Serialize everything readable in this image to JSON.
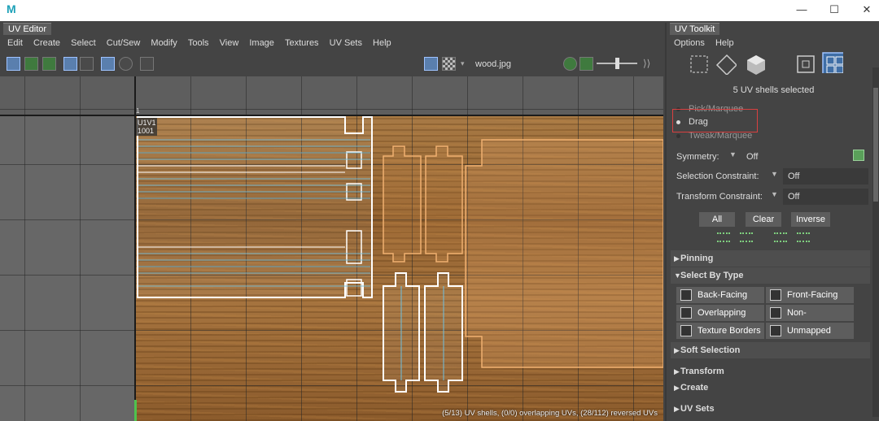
{
  "window": {
    "logo": "M",
    "minimize": "—",
    "maximize": "☐",
    "close": "✕"
  },
  "uv_editor": {
    "tab_title": "UV Editor",
    "menu": [
      "Edit",
      "Create",
      "Select",
      "Cut/Sew",
      "Modify",
      "Tools",
      "View",
      "Image",
      "Textures",
      "UV Sets",
      "Help"
    ],
    "texture_name": "wood.jpg",
    "tile_label_line1": "U1V1",
    "tile_label_line2": "1001",
    "ruler_tick": "1",
    "status": "(5/13) UV shells, (0/0) overlapping UVs, (28/112) reversed UVs"
  },
  "uv_toolkit": {
    "tab_title": "UV Toolkit",
    "menu": [
      "Options",
      "Help"
    ],
    "selection_info": "5 UV shells selected",
    "modes": [
      {
        "label": "Pick/Marquee",
        "active": false
      },
      {
        "label": "Drag",
        "active": true
      },
      {
        "label": "Tweak/Marquee",
        "active": false
      }
    ],
    "symmetry_label": "Symmetry:",
    "symmetry_value": "Off",
    "selection_constraint_label": "Selection Constraint:",
    "selection_constraint_value": "Off",
    "transform_constraint_label": "Transform Constraint:",
    "transform_constraint_value": "Off",
    "buttons": {
      "all": "All",
      "clear": "Clear",
      "inverse": "Inverse"
    },
    "sections": {
      "pinning": "Pinning",
      "select_by_type": "Select By Type",
      "soft_selection": "Soft Selection",
      "transform": "Transform",
      "create": "Create",
      "uv_sets": "UV Sets"
    },
    "select_types": [
      "Back-Facing",
      "Front-Facing",
      "Overlapping",
      "Non-Overlapping",
      "Texture Borders",
      "Unmapped"
    ]
  },
  "colors": {
    "accent_blue": "#5a7fae",
    "highlight_red": "#d94040",
    "uv_selected": "#ffffff",
    "uv_unselected": "#f0b070"
  }
}
